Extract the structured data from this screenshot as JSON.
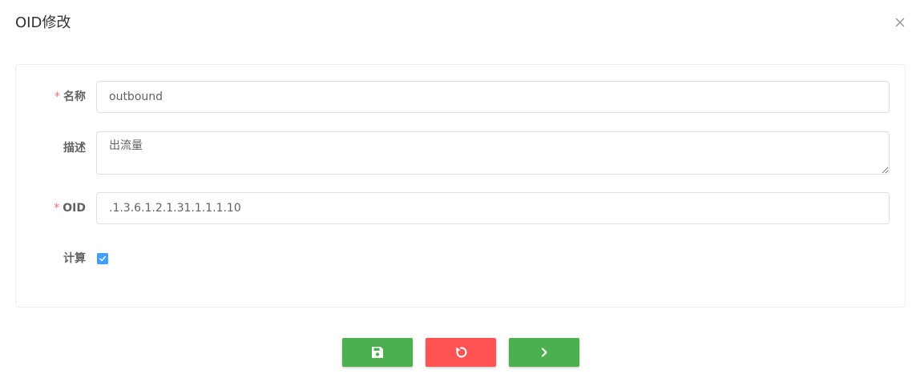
{
  "dialog": {
    "title": "OID修改"
  },
  "form": {
    "name": {
      "label": "名称",
      "required_mark": "*",
      "value": "outbound"
    },
    "description": {
      "label": "描述",
      "value": "出流量"
    },
    "oid": {
      "label": "OID",
      "required_mark": "*",
      "value": ".1.3.6.1.2.1.31.1.1.1.10"
    },
    "calculate": {
      "label": "计算",
      "checked": true
    }
  },
  "buttons": {
    "save": {
      "icon": "save-icon",
      "color": "#4caf50"
    },
    "reset": {
      "icon": "reset-icon",
      "color": "#ff5252"
    },
    "next": {
      "icon": "chevron-right-icon",
      "color": "#4caf50"
    }
  },
  "colors": {
    "required": "#f56c6c",
    "checkbox": "#409eff",
    "border": "#dcdfe6"
  }
}
